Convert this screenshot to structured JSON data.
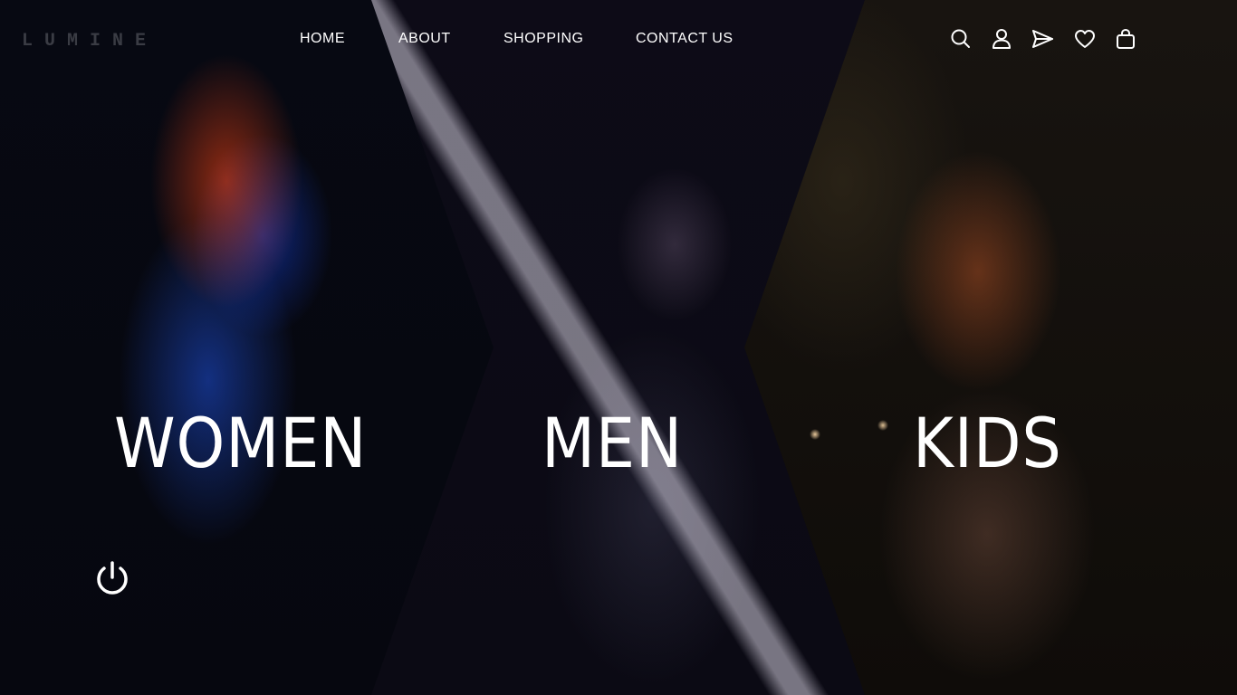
{
  "brand": {
    "logo": "LUMINE"
  },
  "nav": {
    "items": [
      {
        "label": "HOME"
      },
      {
        "label": "ABOUT"
      },
      {
        "label": "SHOPPING"
      },
      {
        "label": "CONTACT US"
      }
    ]
  },
  "header_icons": [
    "search-icon",
    "user-icon",
    "send-icon",
    "heart-icon",
    "shopping-bag-icon"
  ],
  "categories": [
    {
      "label": "WOMEN"
    },
    {
      "label": "MEN"
    },
    {
      "label": "KIDS"
    }
  ],
  "controls": {
    "power_icon": "power-icon"
  },
  "colors": {
    "text": "#ffffff",
    "logo": "#3a3c44",
    "background": "#05060c"
  }
}
